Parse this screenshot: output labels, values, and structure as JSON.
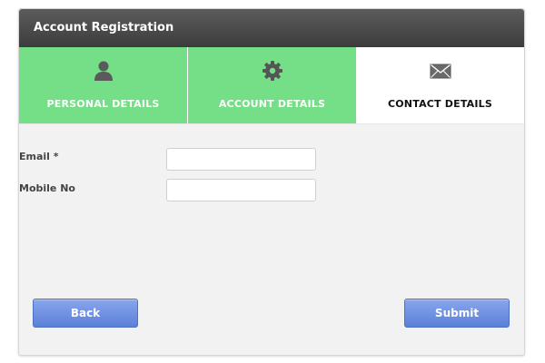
{
  "window": {
    "title": "Account Registration"
  },
  "steps": [
    {
      "label": "PERSONAL DETAILS",
      "icon": "user-icon",
      "state": "done"
    },
    {
      "label": "ACCOUNT DETAILS",
      "icon": "gear-icon",
      "state": "done"
    },
    {
      "label": "CONTACT DETAILS",
      "icon": "envelope-icon",
      "state": "active"
    }
  ],
  "form": {
    "email": {
      "label": "Email *",
      "value": "",
      "placeholder": ""
    },
    "mobile": {
      "label": "Mobile No",
      "value": "",
      "placeholder": ""
    }
  },
  "buttons": {
    "back": "Back",
    "submit": "Submit"
  },
  "colors": {
    "titlebar": "#4a4a4a",
    "step_done": "#74df86",
    "step_active": "#ffffff",
    "button": "#6f91e4",
    "panel": "#f2f2f2"
  }
}
